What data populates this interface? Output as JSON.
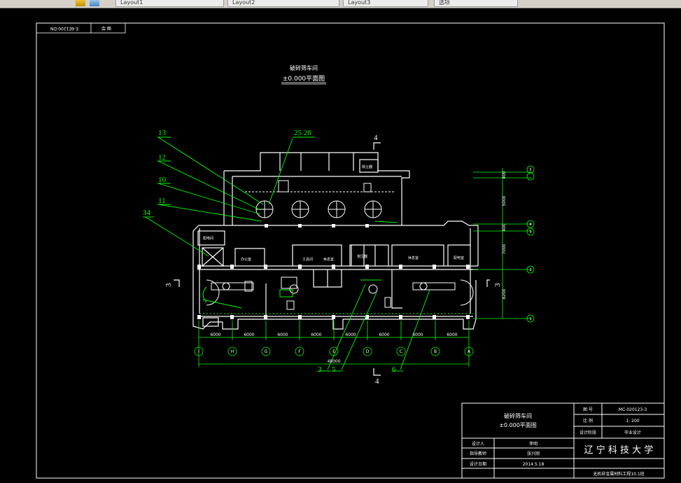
{
  "toolbar": {
    "tabs": [
      "Layout1",
      "Layout2",
      "Layout3",
      "选项"
    ],
    "icons": [
      "layer-icon",
      "properties-icon"
    ]
  },
  "drawing_frame": {
    "stamp_top_left": "E-6E1200-DN",
    "stamp_top_right": "会 图"
  },
  "plan": {
    "title_line1": "破碎筛车间",
    "title_line2": "±0.000平面图",
    "leaders_left": [
      "13",
      "12",
      "10",
      "11",
      "34"
    ],
    "leader_top": "25 26",
    "section_top": "4",
    "section_bottom": "4",
    "section_left": "3",
    "section_right": "3",
    "leaders_bottom": [
      "3",
      "5",
      "6"
    ],
    "spans": [
      "6000",
      "6000",
      "6000",
      "6000",
      "6000",
      "6000",
      "6000",
      "6000"
    ],
    "total_width": "48000",
    "axis_labels": [
      "I",
      "H",
      "G",
      "F",
      "E",
      "D",
      "C",
      "B",
      "A"
    ],
    "right_dims": [
      "400",
      "5000",
      "400",
      "7000",
      "8200"
    ],
    "room_labels": [
      "除尘器",
      "配电间",
      "办公室",
      "工具间",
      "休息室",
      "变压器",
      "休息室",
      "配电室"
    ],
    "grid_right_marks": [
      "5",
      "4",
      "3",
      "2",
      "1"
    ]
  },
  "title_block": {
    "drawing_title_line1": "破碎筛车间",
    "drawing_title_line2": "±0.000平面图",
    "rows_left": [
      {
        "label": "设计人",
        "value": "李明"
      },
      {
        "label": "指导教师",
        "value": "张兴刚"
      },
      {
        "label": "设计日期",
        "value": "2014.5.18"
      }
    ],
    "rows_right": [
      {
        "label": "图 号",
        "value": "MC-020123-3"
      },
      {
        "label": "比 例",
        "value": "1: 200"
      },
      {
        "label": "设计阶段",
        "value": "毕业设计"
      }
    ],
    "university": "辽 宁 科 技 大 学",
    "class": "无机非金属材料工程10.1班"
  }
}
